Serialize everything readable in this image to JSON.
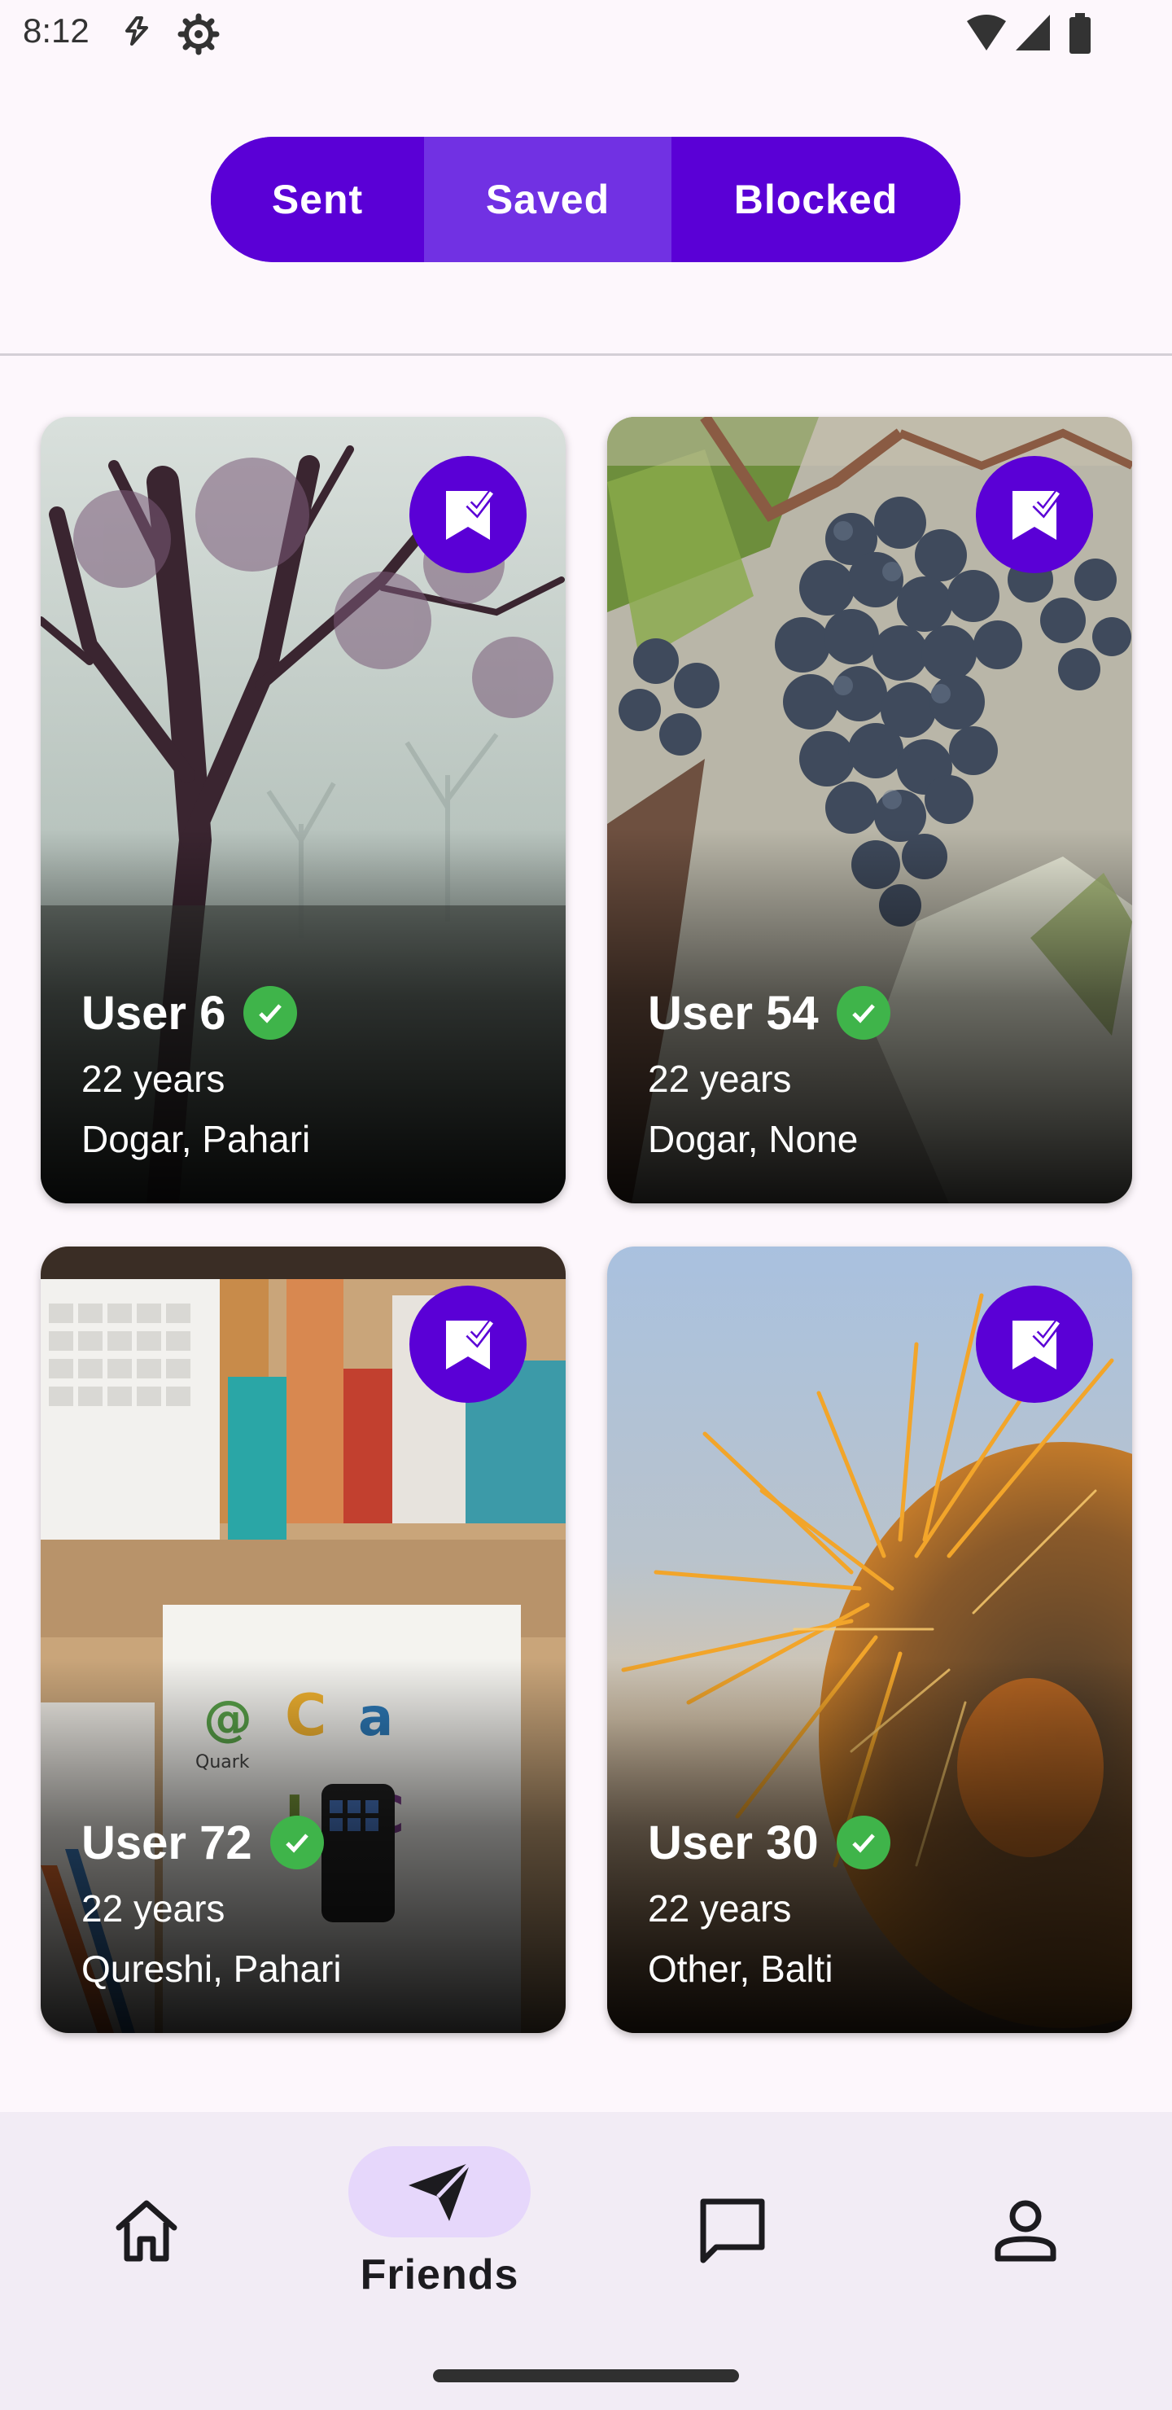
{
  "status_bar": {
    "time": "8:12"
  },
  "tabs": [
    {
      "label": "Sent",
      "selected": false
    },
    {
      "label": "Saved",
      "selected": true
    },
    {
      "label": "Blocked",
      "selected": false
    }
  ],
  "cards": [
    {
      "name": "User 6",
      "age": "22 years",
      "location": "Dogar, Pahari",
      "verified": true,
      "saved": true
    },
    {
      "name": "User 54",
      "age": "22 years",
      "location": "Dogar, None",
      "verified": true,
      "saved": true
    },
    {
      "name": "User 72",
      "age": "22 years",
      "location": "Qureshi, Pahari",
      "verified": true,
      "saved": true
    },
    {
      "name": "User 30",
      "age": "22 years",
      "location": "Other, Balti",
      "verified": true,
      "saved": true
    }
  ],
  "bottom_nav": {
    "items": [
      {
        "icon": "home-icon",
        "label": ""
      },
      {
        "icon": "send-icon",
        "label": "Friends",
        "active": true
      },
      {
        "icon": "chat-icon",
        "label": ""
      },
      {
        "icon": "person-icon",
        "label": ""
      }
    ]
  },
  "colors": {
    "primary": "#5a00d6",
    "selected_tab": "#7131e3",
    "verified": "#3fb44a",
    "nav_bg": "#f2ecf5",
    "nav_pill": "#e6d7fb"
  }
}
